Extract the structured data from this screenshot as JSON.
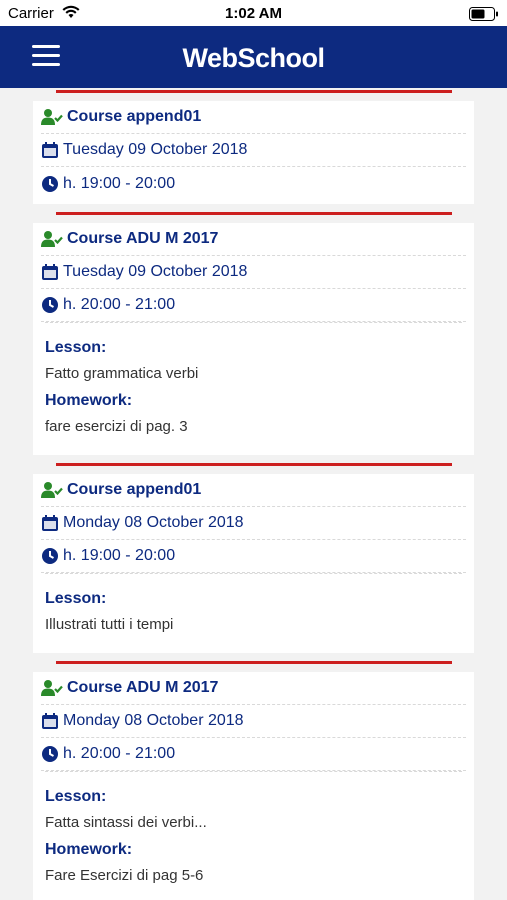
{
  "status": {
    "carrier": "Carrier",
    "time": "1:02 AM"
  },
  "nav": {
    "title": "WebSchool"
  },
  "labels": {
    "lesson": "Lesson:",
    "homework": "Homework:"
  },
  "entries": [
    {
      "course": "Course append01",
      "date": "Tuesday 09 October 2018",
      "time": "h. 19:00 - 20:00"
    },
    {
      "course": "Course ADU M 2017",
      "date": "Tuesday 09 October 2018",
      "time": "h. 20:00 - 21:00",
      "lesson": "Fatto grammatica verbi",
      "homework": "fare esercizi di pag. 3"
    },
    {
      "course": "Course append01",
      "date": "Monday 08 October 2018",
      "time": "h. 19:00 - 20:00",
      "lesson": "Illustrati tutti i tempi"
    },
    {
      "course": "Course ADU M 2017",
      "date": "Monday 08 October 2018",
      "time": "h. 20:00 - 21:00",
      "lesson": "Fatta sintassi dei verbi...",
      "homework": "Fare Esercizi di pag 5-6"
    }
  ]
}
